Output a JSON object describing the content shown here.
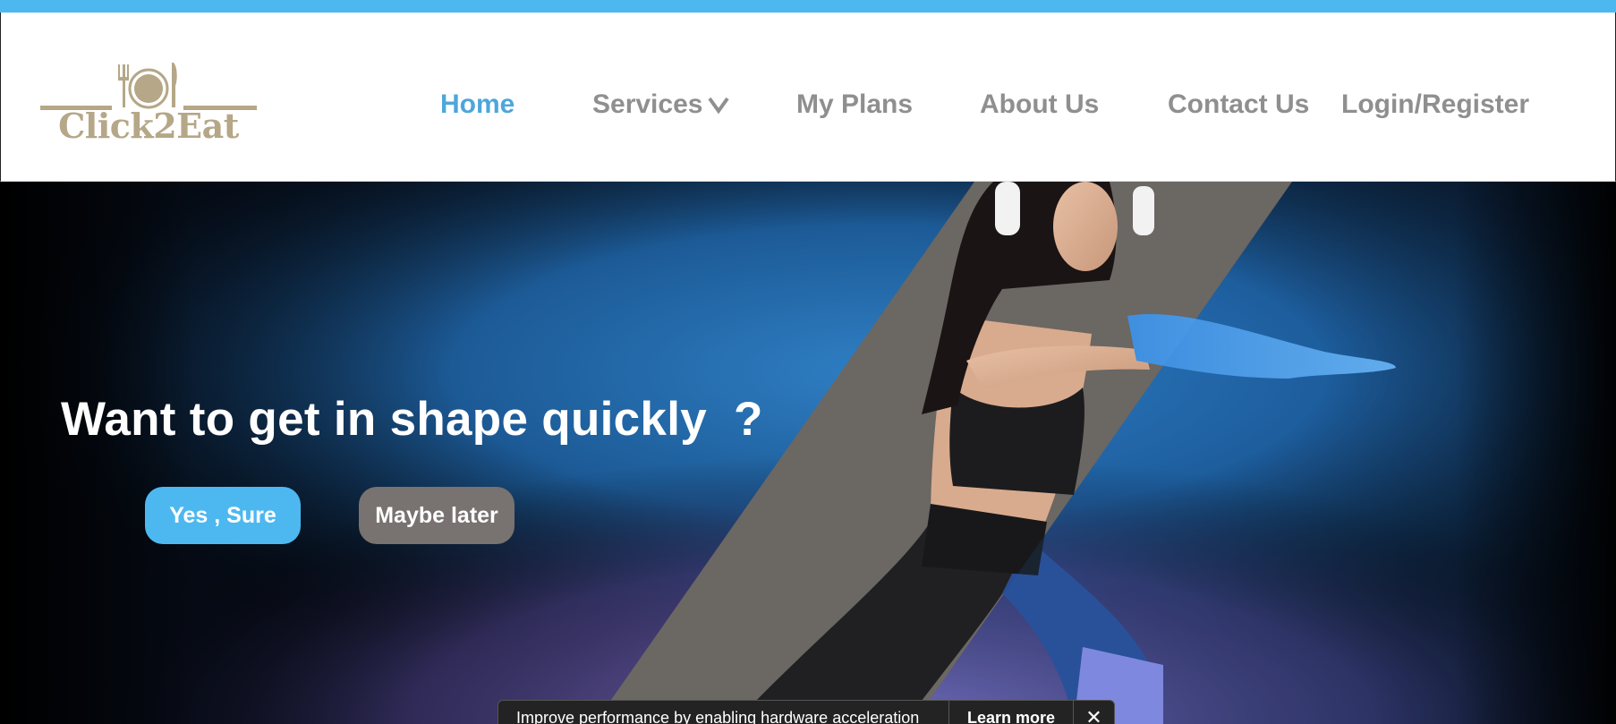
{
  "brand": {
    "name": "Click2Eat",
    "logo_icon": "plate-fork-knife-icon",
    "color": "#b5a787"
  },
  "nav": {
    "items": [
      {
        "label": "Home",
        "active": true
      },
      {
        "label": "Services",
        "has_dropdown": true
      },
      {
        "label": "My Plans"
      },
      {
        "label": "About Us"
      },
      {
        "label": "Contact Us"
      },
      {
        "label": "Login/Register"
      }
    ],
    "active_color": "#4da6dc",
    "color": "#8f8f8f"
  },
  "hero": {
    "headline": "Want to get in shape quickly  ?",
    "primary_button": "Yes , Sure",
    "secondary_button": "Maybe later"
  },
  "toast": {
    "message": "Improve performance by enabling hardware acceleration",
    "learn_more": "Learn more",
    "close_icon": "close-icon"
  },
  "colors": {
    "accent": "#4db8f0",
    "secondary_button": "#787270",
    "top_stripe": "#4db8f0"
  }
}
